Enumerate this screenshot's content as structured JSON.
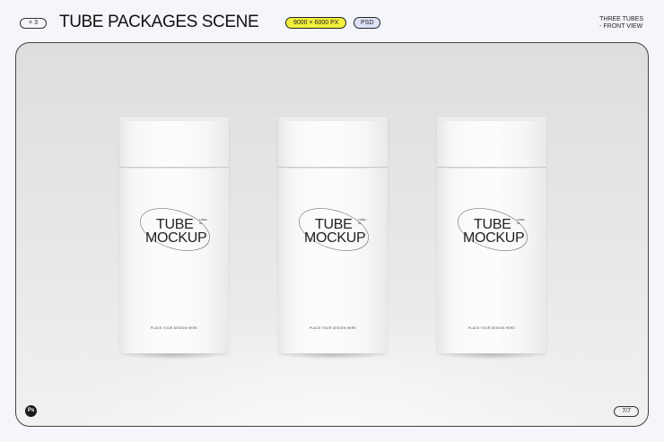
{
  "header": {
    "count_label": "× 3",
    "title": "TUBE PACKAGES SCENE",
    "resolution_badge": "9000 × 6000 PX",
    "format_badge": "PSD",
    "view_note_line1": "THREE TUBES",
    "view_note_line2": "- FRONT VIEW"
  },
  "preview": {
    "tubes": [
      {
        "word1": "TUBE",
        "word2": "MOCKUP",
        "tiny": "LABEL 01",
        "caption": "PLACE YOUR DESIGN HERE"
      },
      {
        "word1": "TUBE",
        "word2": "MOCKUP",
        "tiny": "LABEL 01",
        "caption": "PLACE YOUR DESIGN HERE"
      },
      {
        "word1": "TUBE",
        "word2": "MOCKUP",
        "tiny": "LABEL 01",
        "caption": "PLACE YOUR DESIGN HERE"
      }
    ],
    "app_icon_label": "Ps",
    "page_indicator": "7/7"
  },
  "colors": {
    "background": "#f4f6fb",
    "resolution_badge": "#f3ef3b",
    "format_badge": "#dde2f6"
  },
  "icons": {
    "app_icon": "photoshop-icon"
  }
}
